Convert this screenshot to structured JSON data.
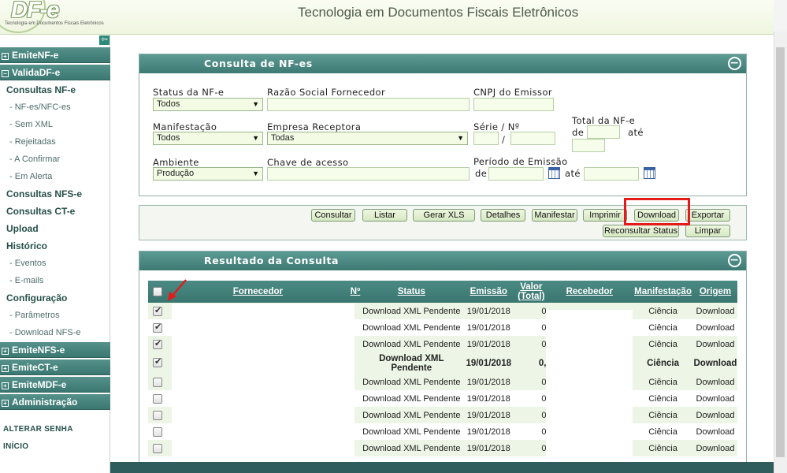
{
  "header": {
    "logo": "DF-e",
    "logo_sub": "Tecnologia em Documentos Fiscais Eletrônicos",
    "title": "Tecnologia em Documentos Fiscais Eletrônicos"
  },
  "sidebar": {
    "sections": {
      "emitenfe": "EmiteNF-e",
      "validadfe": "ValidaDF-e",
      "emitenfse": "EmiteNFS-e",
      "emitecte": "EmiteCT-e",
      "emitemdfe": "EmiteMDF-e",
      "admin": "Administração"
    },
    "items": {
      "consultas_nfe": "Consultas NF-e",
      "nfe_nfce": "NF-es/NFC-es",
      "sem_xml": "Sem XML",
      "rejeitadas": "Rejeitadas",
      "a_confirmar": "A Confirmar",
      "em_alerta": "Em Alerta",
      "consultas_nfse": "Consultas NFS-e",
      "consultas_cte": "Consultas CT-e",
      "upload": "Upload",
      "historico": "Histórico",
      "eventos": "Eventos",
      "emails": "E-mails",
      "configuracao": "Configuração",
      "parametros": "Parâmetros",
      "download_nfse": "Download NFS-e"
    },
    "links": {
      "alterar_senha": "ALTERAR SENHA",
      "inicio": "INÍCIO"
    }
  },
  "consulta": {
    "title": "Consulta de NF-es",
    "labels": {
      "status": "Status da NF-e",
      "razao": "Razão Social Fornecedor",
      "cnpj": "CNPJ do Emissor",
      "total": "Total da NF-e",
      "de1": "de",
      "ate1": "até",
      "manifestacao": "Manifestação",
      "empresa": "Empresa Receptora",
      "serie": "Série  / Nº",
      "slash": "/",
      "ambiente": "Ambiente",
      "chave": "Chave de acesso",
      "periodo": "Período de Emissão",
      "de2": "de",
      "ate2": "até"
    },
    "values": {
      "status": "Todos",
      "manifestacao": "Todos",
      "empresa": "Todas",
      "ambiente": "Produção"
    }
  },
  "toolbar": {
    "consultar": "Consultar",
    "listar": "Listar",
    "gerar_xls": "Gerar XLS",
    "detalhes": "Detalhes",
    "manifestar": "Manifestar",
    "imprimir": "Imprimir",
    "download": "Download",
    "exportar": "Exportar",
    "reconsultar": "Reconsultar Status",
    "limpar": "Limpar"
  },
  "resultado": {
    "title": "Resultado da Consulta",
    "columns": {
      "fornecedor": "Fornecedor",
      "numero": "Nº",
      "status": "Status",
      "emissao": "Emissão",
      "valor": "Valor (Total)",
      "recebedor": "Recebedor",
      "manifestacao": "Manifestação",
      "origem": "Origem"
    },
    "rows": [
      {
        "checked": true,
        "status": "Download XML Pendente",
        "emissao": "19/01/2018",
        "valor": "0",
        "manifestacao": "Ciência",
        "origem": "Download"
      },
      {
        "checked": true,
        "status": "Download XML Pendente",
        "emissao": "19/01/2018",
        "valor": "0",
        "manifestacao": "Ciência",
        "origem": "Download"
      },
      {
        "checked": true,
        "status": "Download XML Pendente",
        "emissao": "19/01/2018",
        "valor": "0",
        "manifestacao": "Ciência",
        "origem": "Download"
      },
      {
        "checked": true,
        "status": "Download XML Pendente",
        "emissao": "19/01/2018",
        "valor": "0,",
        "manifestacao": "Ciência",
        "origem": "Download"
      },
      {
        "checked": false,
        "status": "Download XML Pendente",
        "emissao": "19/01/2018",
        "valor": "0",
        "manifestacao": "Ciência",
        "origem": "Download"
      },
      {
        "checked": false,
        "status": "Download XML Pendente",
        "emissao": "19/01/2018",
        "valor": "0",
        "manifestacao": "Ciência",
        "origem": "Download"
      },
      {
        "checked": false,
        "status": "Download XML Pendente",
        "emissao": "19/01/2018",
        "valor": "0",
        "manifestacao": "Ciência",
        "origem": "Download"
      },
      {
        "checked": false,
        "status": "Download XML Pendente",
        "emissao": "19/01/2018",
        "valor": "0",
        "manifestacao": "Ciência",
        "origem": "Download"
      },
      {
        "checked": false,
        "status": "Download XML Pendente",
        "emissao": "19/01/2018",
        "valor": "0",
        "manifestacao": "Ciência",
        "origem": "Download"
      }
    ]
  },
  "colors": {
    "accent": "#3d7a74",
    "highlight": "#e31b1b",
    "field_bg": "#f3fbe4"
  },
  "icons": {
    "collapse": "arrow-left-icon",
    "panel_toggle": "minus-circle-icon",
    "calendar": "calendar-icon",
    "pointer": "red-arrow-icon"
  }
}
